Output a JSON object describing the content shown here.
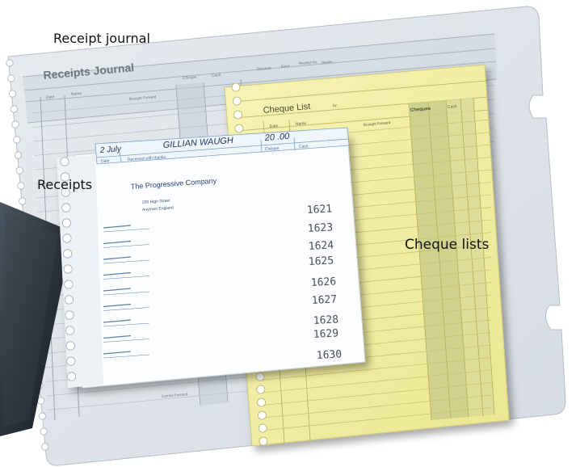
{
  "callouts": {
    "receipt_journal": "Receipt journal",
    "receipts": "Receipts",
    "cheque_lists": "Cheque lists"
  },
  "journal": {
    "title": "Receipts Journal",
    "col_date": "Date",
    "col_name": "Name",
    "col_cheque": "Cheque",
    "col_cash": "Cash",
    "col_discount": "Discount",
    "col_extra": "Extra",
    "col_receipt_no": "Receipt No.",
    "col_details": "Details",
    "brought_forward": "Brought Forward",
    "carried_forward": "Carried Forward"
  },
  "cheque_list": {
    "title": "Cheque List",
    "by": "by",
    "col_date": "Date",
    "col_name": "Name",
    "col_cheques": "Cheques",
    "col_cash": "Cash",
    "brought_forward": "Brought Forward"
  },
  "receipt": {
    "date": "2 July",
    "payer": "GILLIAN WAUGH",
    "amount": "20 .00",
    "label_date": "Date",
    "label_received": "Received with thanks",
    "label_cheque": "Cheque",
    "label_cash": "Cash",
    "company": "The Progressive Company",
    "address1": "200 High Street",
    "address2": "Anytown England",
    "stub_numbers": [
      "1621",
      "1623",
      "1624",
      "1625",
      "1626",
      "1627",
      "1628",
      "1629",
      "1630"
    ]
  },
  "colors": {
    "journal_paper": "#dfe4ea",
    "cheque_paper": "#f2efa3",
    "cheque_column": "#c9cd8a",
    "receipt_paper": "#fbfdff",
    "binder": "#2a333b"
  }
}
